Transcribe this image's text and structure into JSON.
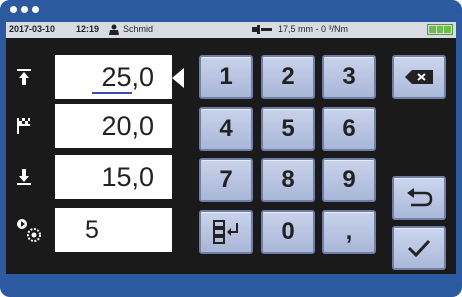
{
  "window": {
    "title_dots": 3
  },
  "status": {
    "date": "2017-03-10",
    "time": "12:19",
    "user": "Schmid",
    "tool_value": "17,5 mm - 0 ³/Nm"
  },
  "params": [
    {
      "name": "upper-limit",
      "icon": "upper-limit-icon",
      "value": "25,0",
      "active": true
    },
    {
      "name": "target",
      "icon": "target-flag-icon",
      "value": "20,0",
      "active": false
    },
    {
      "name": "lower-limit",
      "icon": "lower-limit-icon",
      "value": "15,0",
      "active": false
    },
    {
      "name": "cycles",
      "icon": "cycle-gear-icon",
      "value": "5",
      "active": false
    }
  ],
  "keypad": {
    "digits": [
      "1",
      "2",
      "3",
      "4",
      "5",
      "6",
      "7",
      "8",
      "9",
      "0",
      ","
    ],
    "backspace_icon": "backspace-icon",
    "next-field_icon": "next-field-icon",
    "undo_icon": "undo-icon",
    "confirm_icon": "check-icon"
  },
  "colors": {
    "frame": "#2b5aa0",
    "key_face": "#b7c3e0",
    "key_border": "#6f7fa8",
    "battery": "#6cc04a",
    "cursor": "#3b4fb0"
  }
}
